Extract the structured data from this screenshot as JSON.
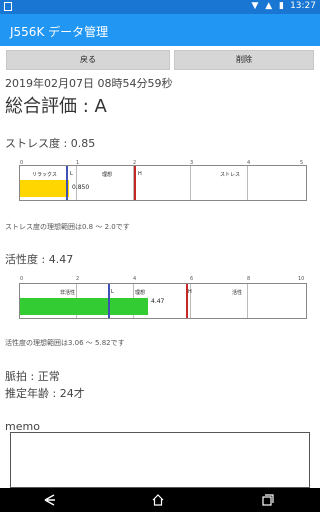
{
  "status_bar": {
    "clock": "13:27"
  },
  "app_bar": {
    "title": "J556K データ管理"
  },
  "buttons": {
    "back": "戻る",
    "delete": "削除"
  },
  "record": {
    "datetime": "2019年02月07日 08時54分59秒",
    "overall_label": "総合評価 : ",
    "overall_value": "A"
  },
  "stress": {
    "label": "ストレス度 : ",
    "value": "0.85",
    "scale": [
      "0",
      "1",
      "2",
      "3",
      "4",
      "5"
    ],
    "zones": {
      "relax": "リラックス",
      "L": "L",
      "ideal": "理想",
      "H": "H",
      "stress": "ストレス"
    },
    "value_label": "0.850",
    "ideal_range_note": "ストレス度の理想範囲は0.8 ～ 2.0です",
    "bar_color": "#ffd600",
    "marker_low_color": "#3f51b5",
    "marker_high_color": "#c62828"
  },
  "activity": {
    "label": "活性度 : ",
    "value": "4.47",
    "scale": [
      "0",
      "2",
      "4",
      "6",
      "8",
      "10"
    ],
    "zones": {
      "inactive": "非活性",
      "L": "L",
      "ideal": "理想",
      "H": "H",
      "active": "活性"
    },
    "value_label": "4.47",
    "ideal_range_note": "活性度の理想範囲は3.06 ～ 5.82です",
    "bar_color": "#33cc33",
    "marker_low_color": "#3f51b5",
    "marker_high_color": "#c62828"
  },
  "vitals": {
    "pulse_label": "脈拍 : ",
    "pulse_value": "正常",
    "age_label": "推定年齢 : ",
    "age_value": "24才"
  },
  "memo": {
    "label": "memo",
    "value": ""
  }
}
